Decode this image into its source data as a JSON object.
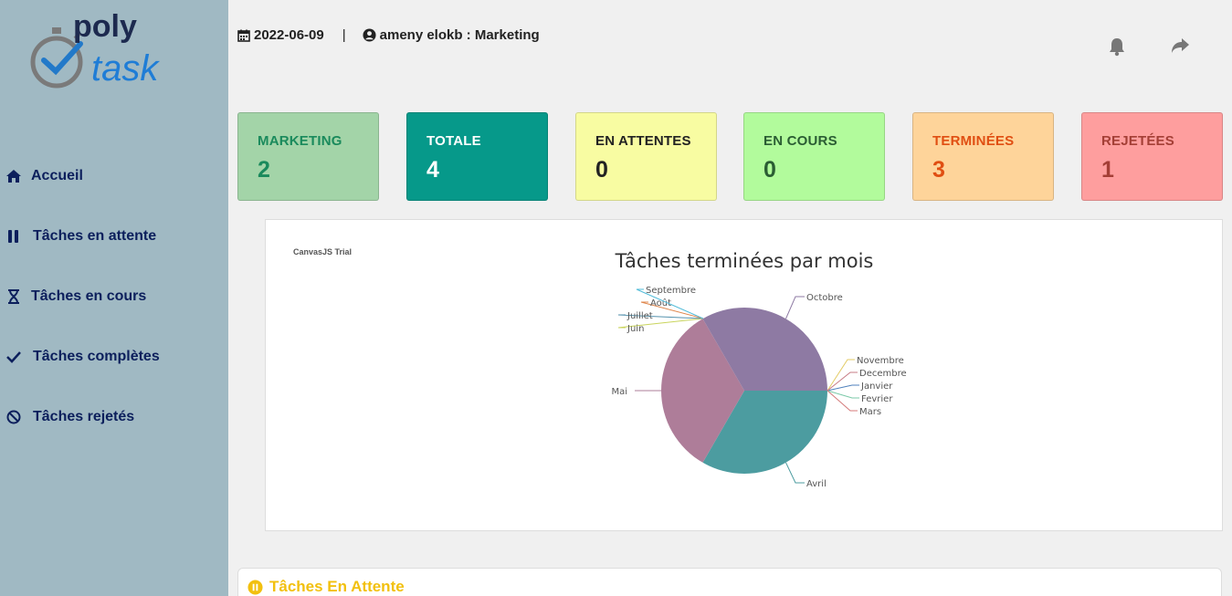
{
  "logo": {
    "top_text": "poly",
    "bottom_text": "task"
  },
  "nav": [
    {
      "label": "Accueil",
      "icon": "home-icon"
    },
    {
      "label": "Tâches en attente",
      "icon": "pause-icon"
    },
    {
      "label": "Tâches en cours",
      "icon": "hourglass-icon"
    },
    {
      "label": "Tâches complètes",
      "icon": "check-icon"
    },
    {
      "label": "Tâches rejetés",
      "icon": "ban-icon"
    }
  ],
  "header": {
    "date": "2022-06-09",
    "separator": "|",
    "user": "ameny elokb : Marketing"
  },
  "stats": [
    {
      "label": "MARKETING",
      "value": "2",
      "bg": "#a3d4a8",
      "fg": "#1a8a5c"
    },
    {
      "label": "TOTALE",
      "value": "4",
      "bg": "#06998a",
      "fg": "#ffffff"
    },
    {
      "label": "EN ATTENTES",
      "value": "0",
      "bg": "#f8fca2",
      "fg": "#222222"
    },
    {
      "label": "EN COURS",
      "value": "0",
      "bg": "#b2fb9c",
      "fg": "#2a5d33"
    },
    {
      "label": "TERMINÉES",
      "value": "3",
      "bg": "#fed49a",
      "fg": "#e04e12"
    },
    {
      "label": "REJETÉES",
      "value": "1",
      "bg": "#fe9e9e",
      "fg": "#a43f36"
    }
  ],
  "chart_data": {
    "type": "pie",
    "title": "Tâches terminées par mois",
    "watermark": "CanvasJS Trial",
    "slices": [
      {
        "label": "Janvier",
        "value": 0,
        "color": "#4f81bc"
      },
      {
        "label": "Fevrier",
        "value": 0,
        "color": "#7bc9a8"
      },
      {
        "label": "Mars",
        "value": 0,
        "color": "#d47a7a"
      },
      {
        "label": "Avril",
        "value": 1,
        "color": "#4c9ca0"
      },
      {
        "label": "Mai",
        "value": 1,
        "color": "#ae7d99"
      },
      {
        "label": "Juin",
        "value": 0,
        "color": "#c9d45c"
      },
      {
        "label": "Juillet",
        "value": 0,
        "color": "#5592ad"
      },
      {
        "label": "Août",
        "value": 0,
        "color": "#df874d"
      },
      {
        "label": "Septembre",
        "value": 0,
        "color": "#52bcd9"
      },
      {
        "label": "Octobre",
        "value": 1,
        "color": "#8e7aa3"
      },
      {
        "label": "Novembre",
        "value": 0,
        "color": "#e3cb64"
      },
      {
        "label": "Decembre",
        "value": 0,
        "color": "#c77b85"
      }
    ]
  },
  "pending": {
    "title": "Tâches En Attente"
  }
}
